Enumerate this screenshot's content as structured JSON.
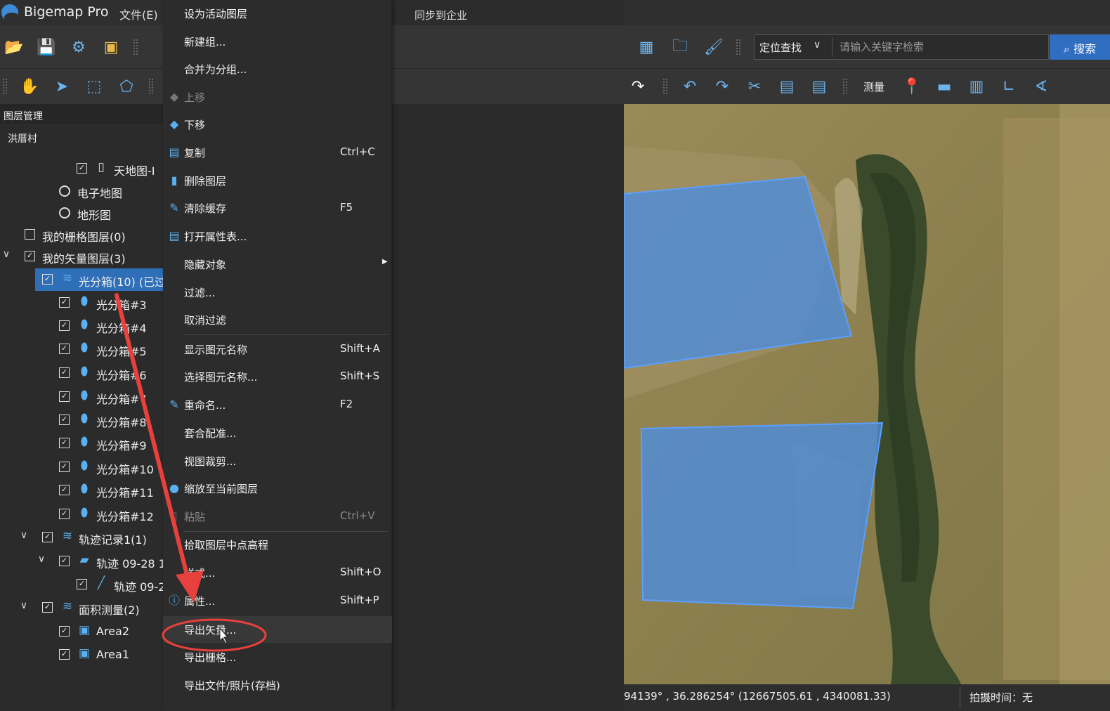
{
  "app": {
    "title": "Bigemap Pro",
    "menu_file": "文件(E)",
    "sync_enterprise": "同步到企业"
  },
  "toolbar": {
    "locate_select": "定位查找",
    "search_placeholder": "请输入关键字检索",
    "search_button": "搜索",
    "measure_label": "测量"
  },
  "layer_panel": {
    "title": "图层管理",
    "project": "洪厝村",
    "rows": [
      {
        "label": "天地图-I",
        "kind": "checkbox",
        "checked": true,
        "icon": "map-icon"
      },
      {
        "label": "电子地图",
        "kind": "radio"
      },
      {
        "label": "地形图",
        "kind": "radio"
      },
      {
        "label": "我的栅格图层(0)",
        "kind": "checkbox",
        "checked": false
      },
      {
        "label": "我的矢量图层(3)",
        "kind": "checkbox",
        "checked": true,
        "expanded": true
      },
      {
        "label": "光分箱(10) (已过",
        "kind": "checkbox",
        "checked": true,
        "expanded": true,
        "selected": true,
        "icon": "layers-icon"
      },
      {
        "label": "光分箱#3",
        "icon": "pin-icon"
      },
      {
        "label": "光分箱#4",
        "icon": "pin-icon"
      },
      {
        "label": "光分箱#5",
        "icon": "pin-icon"
      },
      {
        "label": "光分箱#6",
        "icon": "pin-icon"
      },
      {
        "label": "光分箱#7",
        "icon": "pin-icon"
      },
      {
        "label": "光分箱#8",
        "icon": "pin-icon"
      },
      {
        "label": "光分箱#9",
        "icon": "pin-icon"
      },
      {
        "label": "光分箱#10",
        "icon": "pin-icon"
      },
      {
        "label": "光分箱#11",
        "icon": "pin-icon"
      },
      {
        "label": "光分箱#12",
        "icon": "pin-icon"
      },
      {
        "label": "轨迹记录1(1)",
        "icon": "layers-icon",
        "expanded": true
      },
      {
        "label": "轨迹 09-28 1",
        "icon": "folder-icon",
        "expanded": true
      },
      {
        "label": "轨迹 09-2",
        "icon": "track-icon"
      },
      {
        "label": "面积测量(2)",
        "icon": "layers-icon",
        "expanded": true
      },
      {
        "label": "Area2",
        "icon": "area-icon"
      },
      {
        "label": "Area1",
        "icon": "area-icon"
      }
    ]
  },
  "context_menu": {
    "items": [
      {
        "label": "设为活动图层",
        "shortcut": ""
      },
      {
        "label": "新建组...",
        "shortcut": ""
      },
      {
        "label": "合并为分组...",
        "shortcut": ""
      },
      {
        "label": "上移",
        "shortcut": "",
        "disabled": true
      },
      {
        "label": "下移",
        "shortcut": ""
      },
      {
        "label": "复制",
        "shortcut": "Ctrl+C"
      },
      {
        "label": "删除图层",
        "shortcut": ""
      },
      {
        "label": "清除缓存",
        "shortcut": "F5"
      },
      {
        "label": "打开属性表...",
        "shortcut": ""
      },
      {
        "label": "隐藏对象",
        "shortcut": ""
      },
      {
        "label": "过滤...",
        "shortcut": ""
      },
      {
        "label": "取消过滤",
        "shortcut": ""
      },
      {
        "label": "显示图元名称",
        "shortcut": "Shift+A"
      },
      {
        "label": "选择图元名称...",
        "shortcut": "Shift+S"
      },
      {
        "label": "重命名...",
        "shortcut": "F2"
      },
      {
        "label": "套合配准...",
        "shortcut": ""
      },
      {
        "label": "视图裁剪...",
        "shortcut": ""
      },
      {
        "label": "缩放至当前图层",
        "shortcut": ""
      },
      {
        "label": "粘贴",
        "shortcut": "Ctrl+V",
        "disabled": true
      },
      {
        "label": "拾取图层中点高程",
        "shortcut": ""
      },
      {
        "label": "样式...",
        "shortcut": "Shift+O"
      },
      {
        "label": "属性...",
        "shortcut": "Shift+P"
      },
      {
        "label": "导出矢量...",
        "shortcut": "",
        "highlighted": true
      },
      {
        "label": "导出栅格...",
        "shortcut": ""
      },
      {
        "label": "导出文件/照片(存档)",
        "shortcut": ""
      }
    ]
  },
  "status": {
    "coords": "94139° , 36.286254°   (12667505.61 , 4340081.33)",
    "capture_time": "拍摄时间：无"
  },
  "colors": {
    "accent": "#2e6fb8",
    "polygon_fill": "#4a8de0",
    "annotation": "#e8403c"
  }
}
